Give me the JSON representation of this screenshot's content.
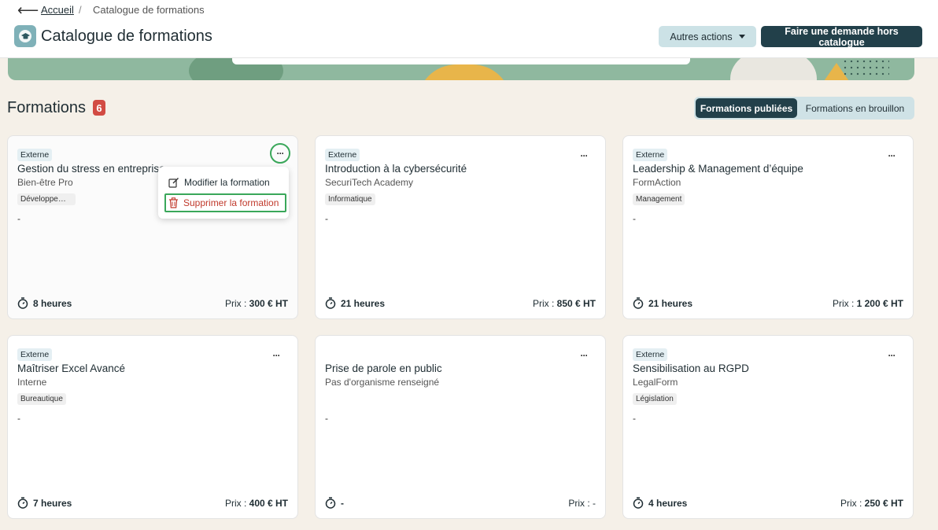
{
  "breadcrumb": {
    "home": "Accueil",
    "separator": "/",
    "current": "Catalogue de formations"
  },
  "header": {
    "title": "Catalogue de formations",
    "other_actions": "Autres actions",
    "request_button": "Faire une demande hors catalogue"
  },
  "section": {
    "title": "Formations",
    "count": "6"
  },
  "toggle": {
    "published": "Formations publiées",
    "draft": "Formations en brouillon"
  },
  "menu": {
    "edit": "Modifier la formation",
    "delete": "Supprimer la formation"
  },
  "cards": [
    {
      "badge": "Externe",
      "more": "···",
      "title": "Gestion du stress en entreprise",
      "org": "Bien-être Pro",
      "tag": "Développement personnel",
      "desc": "-",
      "duration": "8 heures",
      "price_label": "Prix : ",
      "price_value": "300 € HT"
    },
    {
      "badge": "Externe",
      "more": "···",
      "title": "Introduction à la cybersécurité",
      "org": "SecuriTech Academy",
      "tag": "Informatique",
      "desc": "-",
      "duration": "21 heures",
      "price_label": "Prix : ",
      "price_value": "850 € HT"
    },
    {
      "badge": "Externe",
      "more": "···",
      "title": "Leadership & Management d’équipe",
      "org": "FormAction",
      "tag": "Management",
      "desc": "-",
      "duration": "21 heures",
      "price_label": "Prix : ",
      "price_value": "1 200 € HT"
    },
    {
      "badge": "Externe",
      "more": "···",
      "title": "Maîtriser Excel Avancé",
      "org": "Interne",
      "tag": "Bureautique",
      "desc": "-",
      "duration": "7 heures",
      "price_label": "Prix : ",
      "price_value": "400 € HT"
    },
    {
      "badge": "",
      "more": "···",
      "title": "Prise de parole en public",
      "org": "Pas d'organisme renseigné",
      "tag": "",
      "desc": "-",
      "duration": "-",
      "price_label": "Prix : ",
      "price_value": "-"
    },
    {
      "badge": "Externe",
      "more": "···",
      "title": "Sensibilisation au RGPD",
      "org": "LegalForm",
      "tag": "Législation",
      "desc": "-",
      "duration": "4 heures",
      "price_label": "Prix : ",
      "price_value": "250 € HT"
    }
  ],
  "colors": {
    "primary": "#22404a",
    "accent_light": "#cce2e6",
    "badge_red": "#d24b43",
    "focus_green": "#3aa75a",
    "background": "#f5f0e8"
  }
}
